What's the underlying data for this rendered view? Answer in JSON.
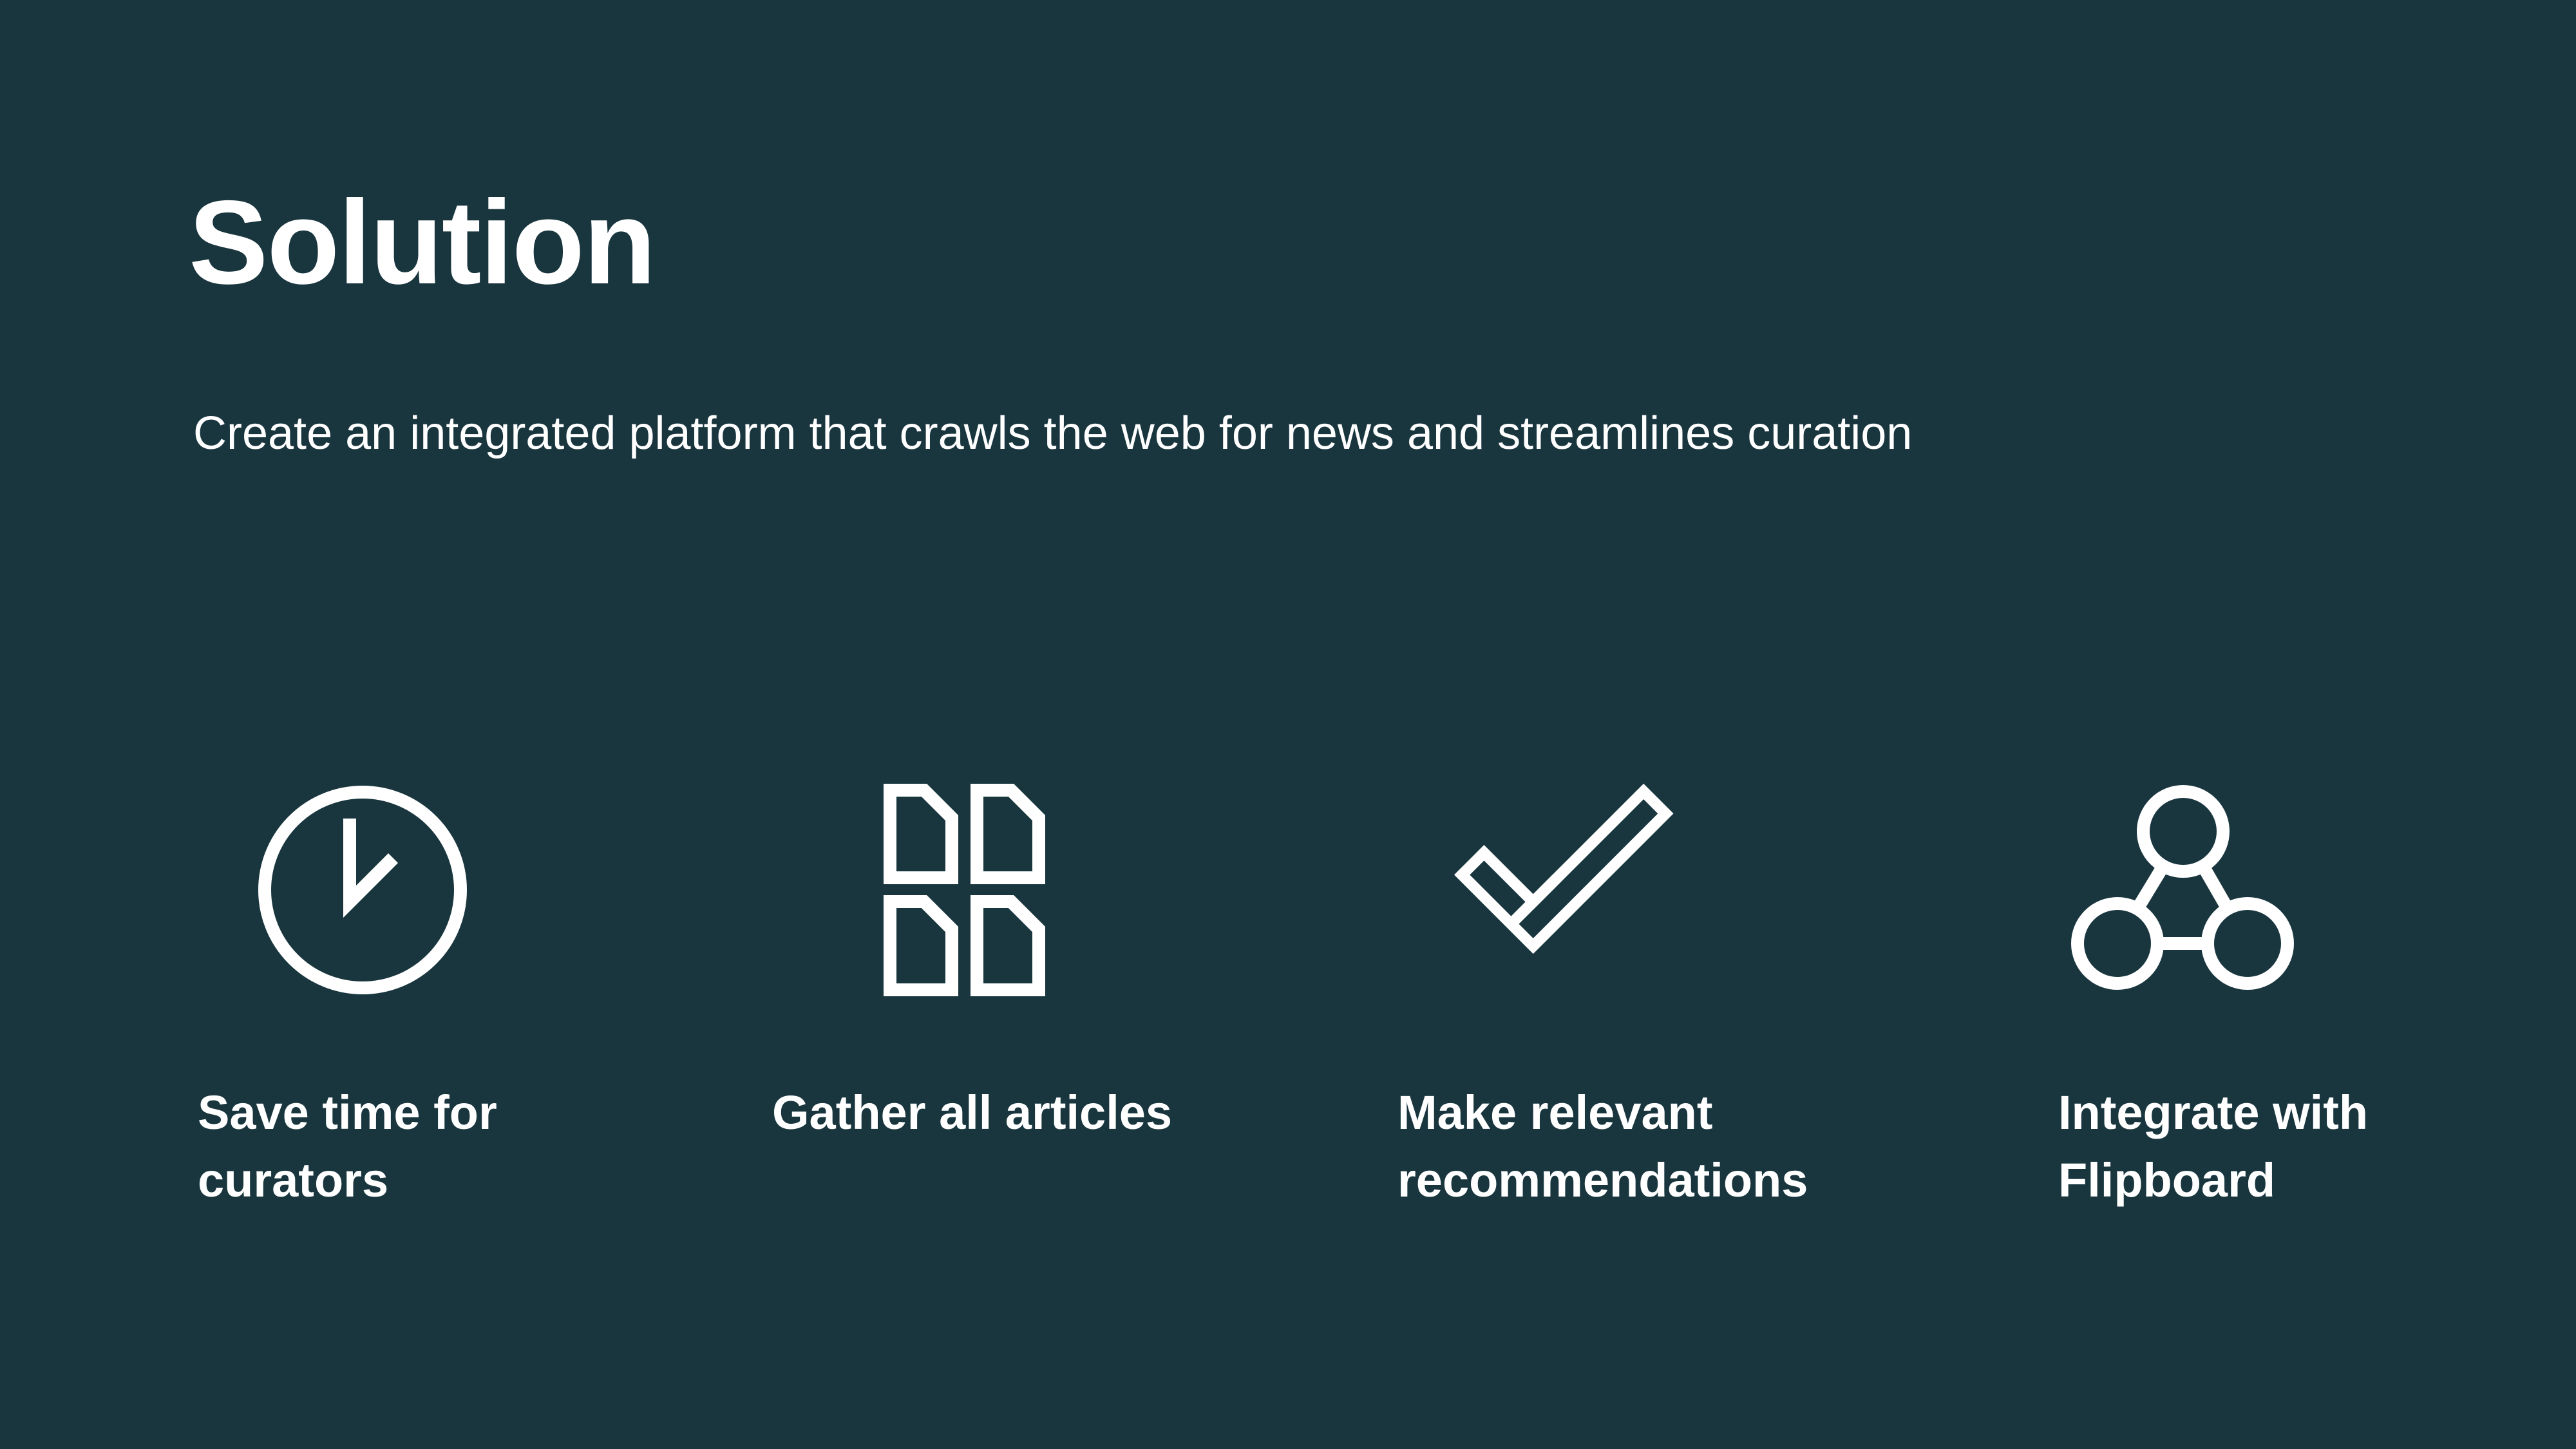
{
  "slide": {
    "title": "Solution",
    "subtitle": "Create an integrated platform that crawls the web for news and streamlines curation",
    "background_color": "#19363F",
    "foreground_color": "#FFFFFF",
    "features": [
      {
        "icon": "clock-icon",
        "label_lines": [
          "Save time for",
          "curators"
        ]
      },
      {
        "icon": "documents-grid-icon",
        "label_lines": [
          "Gather all articles"
        ]
      },
      {
        "icon": "checkmark-icon",
        "label_lines": [
          "Make relevant",
          "recommendations"
        ]
      },
      {
        "icon": "connected-nodes-icon",
        "label_lines": [
          "Integrate with",
          "Flipboard"
        ]
      }
    ]
  }
}
